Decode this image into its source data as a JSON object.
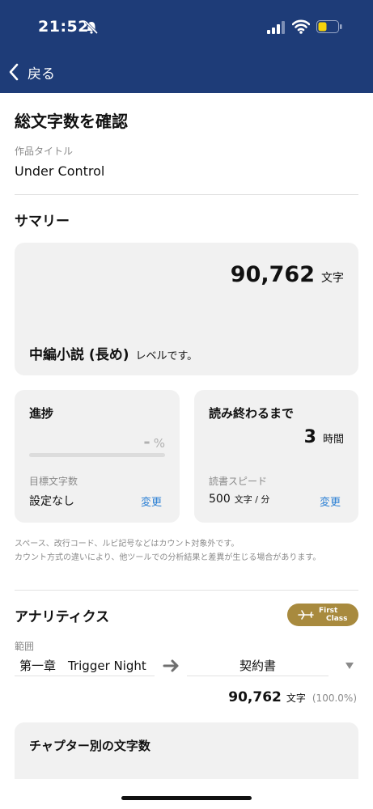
{
  "status_bar": {
    "time": "21:52"
  },
  "nav": {
    "back_label": "戻る"
  },
  "page": {
    "title": "総文字数を確認",
    "work_label": "作品タイトル",
    "work_title": "Under Control"
  },
  "summary": {
    "title": "サマリー",
    "count": "90,762",
    "unit": "文字",
    "level_name": "中編小説 (長め)",
    "level_suffix": "レベルです。"
  },
  "progress": {
    "title": "進捗",
    "percent_value": "-",
    "percent_unit": "%",
    "fill_fraction": 0,
    "goal_label": "目標文字数",
    "goal_value": "設定なし",
    "change_label": "変更"
  },
  "reading": {
    "title": "読み終わるまで",
    "time_value": "3",
    "time_unit": "時間",
    "speed_label": "読書スピード",
    "speed_value": "500",
    "speed_unit": "文字 / 分",
    "change_label": "変更"
  },
  "notes": {
    "line1": "スペース、改行コード、ルビ記号などはカウント対象外です。",
    "line2": "カウント方式の違いにより、他ツールでの分析結果と差異が生じる場合があります。"
  },
  "analytics": {
    "title": "アナリティクス",
    "badge_line1": "First",
    "badge_line2": "Class",
    "badge_color": "#a88a3e",
    "range_label": "範囲",
    "range_from": "第一章　Trigger Night",
    "range_to": "契約書",
    "total_count": "90,762",
    "total_unit": "文字",
    "total_percent": "(100.0%)",
    "chapter_title": "チャプター別の文字数"
  },
  "colors": {
    "header": "#1e3c78",
    "link": "#2a7fd4",
    "card": "#f1f1f1"
  }
}
